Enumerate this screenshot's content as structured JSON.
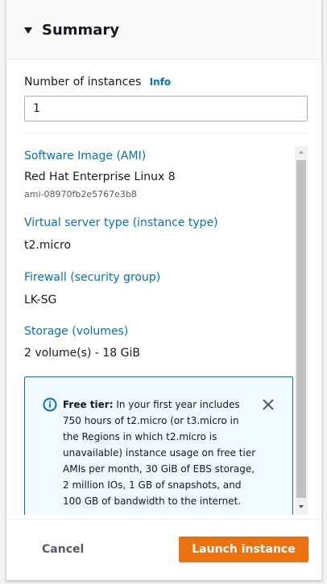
{
  "summary": {
    "title": "Summary",
    "instances": {
      "label": "Number of instances",
      "info_label": "Info",
      "value": "1"
    },
    "ami": {
      "label": "Software Image (AMI)",
      "name": "Red Hat Enterprise Linux 8",
      "id": "ami-08970fb2e5767e3b8"
    },
    "instance_type": {
      "label": "Virtual server type (instance type)",
      "value": "t2.micro"
    },
    "firewall": {
      "label": "Firewall (security group)",
      "value": "LK-SG"
    },
    "storage": {
      "label": "Storage (volumes)",
      "value": "2 volume(s) - 18 GiB"
    },
    "free_tier": {
      "title": "Free tier:",
      "text": " In your first year includes 750 hours of t2.micro (or t3.micro in the Regions in which t2.micro is unavailable) instance usage on free tier AMIs per month, 30 GiB of EBS storage, 2 million IOs, 1 GB of snapshots, and 100 GB of bandwidth to the internet."
    },
    "cancel_label": "Cancel",
    "launch_label": "Launch instance"
  },
  "colors": {
    "link": "#0073bb",
    "primary_button": "#ec7211",
    "alert_bg": "#f1faff"
  },
  "icons": {
    "expand": "caret-down-icon",
    "alert": "info-circle-icon",
    "dismiss": "close-icon"
  }
}
